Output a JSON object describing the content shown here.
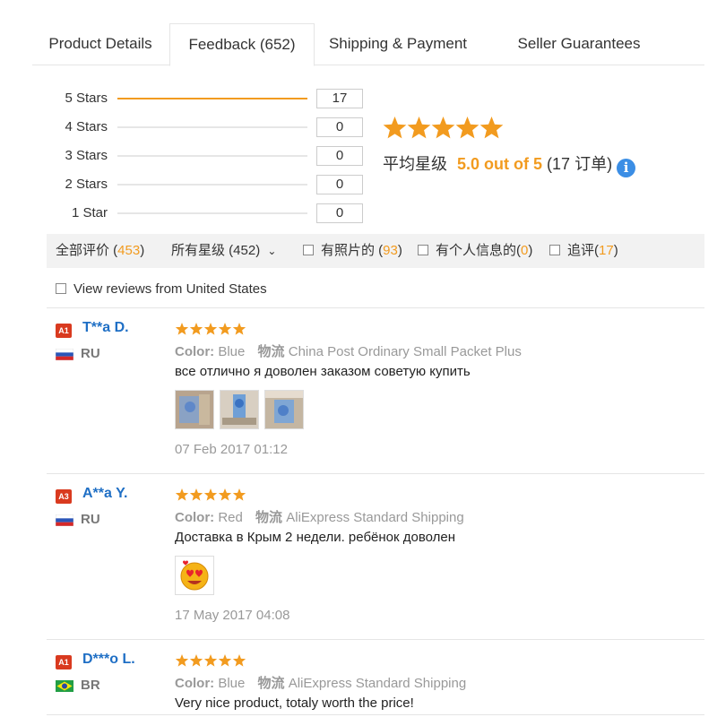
{
  "tabs": [
    {
      "label": "Product Details"
    },
    {
      "label": "Feedback (652)"
    },
    {
      "label": "Shipping & Payment"
    },
    {
      "label": "Seller Guarantees"
    }
  ],
  "histogram": [
    {
      "label": "5 Stars",
      "count": "17",
      "fraction": 1.0
    },
    {
      "label": "4 Stars",
      "count": "0",
      "fraction": 0
    },
    {
      "label": "3 Stars",
      "count": "0",
      "fraction": 0
    },
    {
      "label": "2 Stars",
      "count": "0",
      "fraction": 0
    },
    {
      "label": "1 Star",
      "count": "0",
      "fraction": 0
    }
  ],
  "summary": {
    "stars": 5,
    "avg_label": "平均星级",
    "score_text": "5.0 out of 5",
    "orders_text": "(17 订单)",
    "info_glyph": "i"
  },
  "filters": {
    "all": {
      "label": "全部评价 (",
      "num": "453",
      "close": ")"
    },
    "stars_select": {
      "label": "所有星级 (452)",
      "chevron": "⌄"
    },
    "photos": {
      "label": "有照片的 (",
      "num": "93",
      "close": ")"
    },
    "personal": {
      "label": "有个人信息的(",
      "num": "0",
      "close": ")"
    },
    "additional": {
      "label": "追评(",
      "num": "17",
      "close": ")"
    },
    "us_only": {
      "label": "View reviews from United States"
    }
  },
  "reviews": [
    {
      "level": "A1",
      "name": "T**a D.",
      "country": "RU",
      "flag": "ru",
      "stars": 5,
      "color_key": "Color:",
      "color_value": "Blue",
      "logistics_key": "物流",
      "logistics_value": "China Post Ordinary Small Packet Plus",
      "text": "все отлично я доволен заказом советую купить",
      "photos": 3,
      "date": "07 Feb 2017 01:12"
    },
    {
      "level": "A3",
      "name": "A**a Y.",
      "country": "RU",
      "flag": "ru",
      "stars": 5,
      "color_key": "Color:",
      "color_value": "Red",
      "logistics_key": "物流",
      "logistics_value": "AliExpress Standard Shipping",
      "text": "Доставка в Крым 2 недели. ребёнок доволен",
      "photos": 1,
      "date": "17 May 2017 04:08"
    },
    {
      "level": "A1",
      "name": "D***o L.",
      "country": "BR",
      "flag": "br",
      "stars": 5,
      "color_key": "Color:",
      "color_value": "Blue",
      "logistics_key": "物流",
      "logistics_value": "AliExpress Standard Shipping",
      "text": "Very nice product, totaly worth the price!",
      "photos": 0,
      "date": ""
    }
  ],
  "colors": {
    "accent_orange": "#f29b1f",
    "link_blue": "#1f6fc5",
    "badge_red": "#d93a1f",
    "info_blue": "#3b8ee5"
  }
}
